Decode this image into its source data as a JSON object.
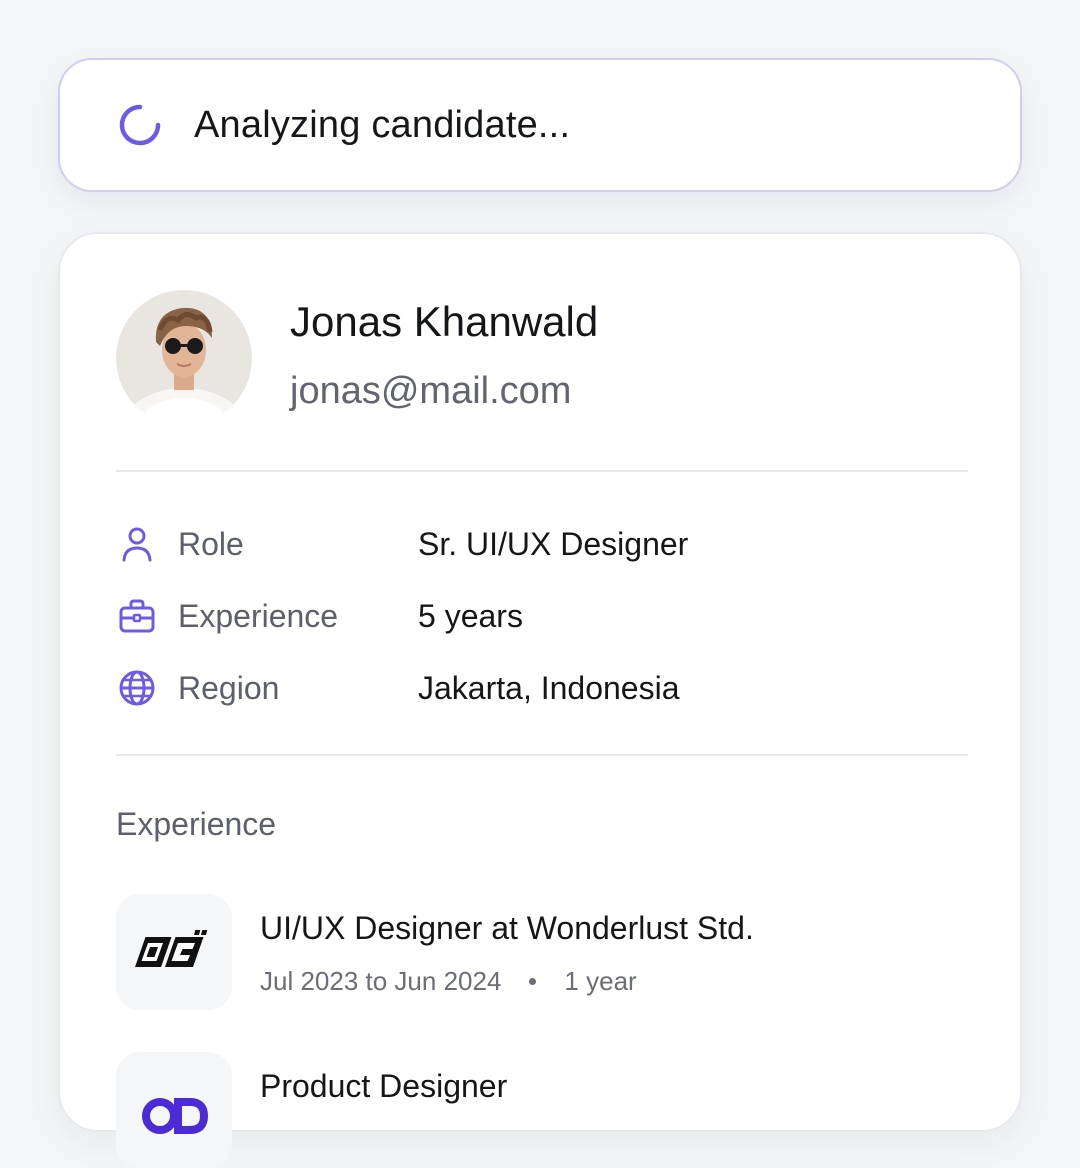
{
  "status": {
    "text": "Analyzing candidate...",
    "icon": "spinner-icon",
    "accent": "#6b5ce7"
  },
  "candidate": {
    "name": "Jonas Khanwald",
    "email": "jonas@mail.com",
    "avatar": "avatar-photo"
  },
  "details": [
    {
      "icon": "user-icon",
      "label": "Role",
      "value": "Sr. UI/UX Designer"
    },
    {
      "icon": "briefcase-icon",
      "label": "Experience",
      "value": "5 years"
    },
    {
      "icon": "globe-icon",
      "label": "Region",
      "value": "Jakarta, Indonesia"
    }
  ],
  "experience": {
    "title": "Experience",
    "items": [
      {
        "title": "UI/UX Designer at Wonderlust Std.",
        "period": "Jul 2023 to Jun 2024",
        "duration": "1 year",
        "logo": "wonderlust-logo"
      },
      {
        "title": "Product Designer",
        "period": "",
        "duration": "",
        "logo": "od-logo"
      }
    ]
  }
}
